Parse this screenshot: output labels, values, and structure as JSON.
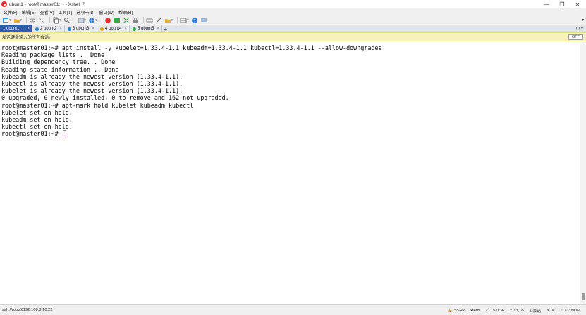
{
  "window": {
    "title": "ubunt1 - root@master01: ~ - Xshell 7",
    "controls": {
      "minimize": "—",
      "maximize": "❐",
      "close": "✕"
    }
  },
  "menu": [
    "文件(F)",
    "编辑(E)",
    "查看(V)",
    "工具(T)",
    "选项卡(B)",
    "窗口(W)",
    "帮助(H)"
  ],
  "tabs": [
    {
      "label": "1 ubunt1",
      "active": true,
      "color": "#2e5ea8"
    },
    {
      "label": "2 ubunt2",
      "active": false,
      "color": "#2f7fd6"
    },
    {
      "label": "3 ubunt3",
      "active": false,
      "color": "#2f7fd6"
    },
    {
      "label": "4 ubunt4",
      "active": false,
      "color": "#d9a400"
    },
    {
      "label": "5 ubunt5",
      "active": false,
      "color": "#3aa83a"
    }
  ],
  "tab_close": "×",
  "tab_add": "+",
  "tab_nav": "‹ › ▾",
  "compose": {
    "text": "发送键盘输入的所有会话。",
    "off_button": "OFF"
  },
  "terminal": {
    "lines": [
      "root@master01:~# apt install -y kubelet=1.33.4-1.1 kubeadm=1.33.4-1.1 kubectl=1.33.4-1.1 --allow-downgrades",
      "Reading package lists... Done",
      "Building dependency tree... Done",
      "Reading state information... Done",
      "kubeadm is already the newest version (1.33.4-1.1).",
      "kubectl is already the newest version (1.33.4-1.1).",
      "kubelet is already the newest version (1.33.4-1.1).",
      "0 upgraded, 0 newly installed, 0 to remove and 162 not upgraded.",
      "root@master01:~# apt-mark hold kubelet kubeadm kubectl",
      "kubelet set on hold.",
      "kubeadm set on hold.",
      "kubectl set on hold."
    ],
    "prompt": "root@master01:~# ",
    "cursor_color": "#33cc33"
  },
  "status": {
    "connection": "ssh://root@192.168.8.10:22",
    "protocol": "SSH2",
    "terminal_type": "xterm",
    "size": "157x36",
    "position": "13,18",
    "sessions": "5 会话",
    "caps": "CAP",
    "num": "NUM"
  },
  "colors": {
    "accent": "#2e5ea8",
    "compose_bg": "#f7f1bd",
    "chrome": "#f0f0f0"
  }
}
